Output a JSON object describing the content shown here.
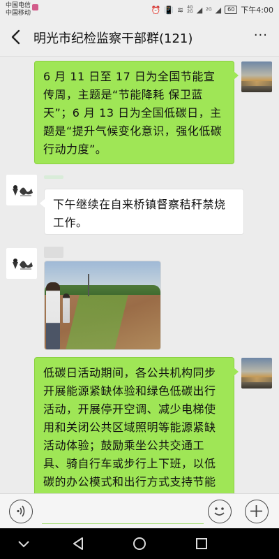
{
  "status_bar": {
    "carrier1": "中国电信",
    "carrier2": "中国移动",
    "net_top": "4G",
    "net_bottom": "2G",
    "net2_top": "2G",
    "battery": "60",
    "time": "下午4:00"
  },
  "header": {
    "title": "明光市纪检监察干部群(121)",
    "more": "···"
  },
  "messages": [
    {
      "side": "self",
      "text": "6 月 11 日至 17 日为全国节能宣传周，主题是“节能降耗 保卫蓝天”；6 月 13 日为全国低碳日，主题是“提升气候变化意识，强化低碳行动力度”。"
    },
    {
      "side": "other",
      "text": "下午继续在自来桥镇督察秸秆禁烧工作。"
    },
    {
      "side": "other",
      "type": "image"
    },
    {
      "side": "self",
      "text": "低碳日活动期间，各公共机构同步开展能源紧缺体验和绿色低碳出行活动，开展停开空调、减少电梯使用和关闭公共区域照明等能源紧缺活动体验；鼓励乘坐公共交通工具、骑自行车或步行上下班，以低碳的办公模式和出行方式支持节能"
    }
  ],
  "input": {
    "placeholder": ""
  },
  "colors": {
    "self_bubble": "#9fe656",
    "other_bubble": "#ffffff",
    "chat_bg": "#ececec"
  },
  "icons": {
    "back": "chevron-left-icon",
    "more": "more-dots-icon",
    "voice": "voice-icon",
    "emoji": "emoji-icon",
    "plus": "plus-icon",
    "nav_back": "triangle-back-icon",
    "nav_home": "circle-home-icon",
    "nav_recent": "square-recent-icon",
    "nav_down": "chevron-down-icon"
  }
}
